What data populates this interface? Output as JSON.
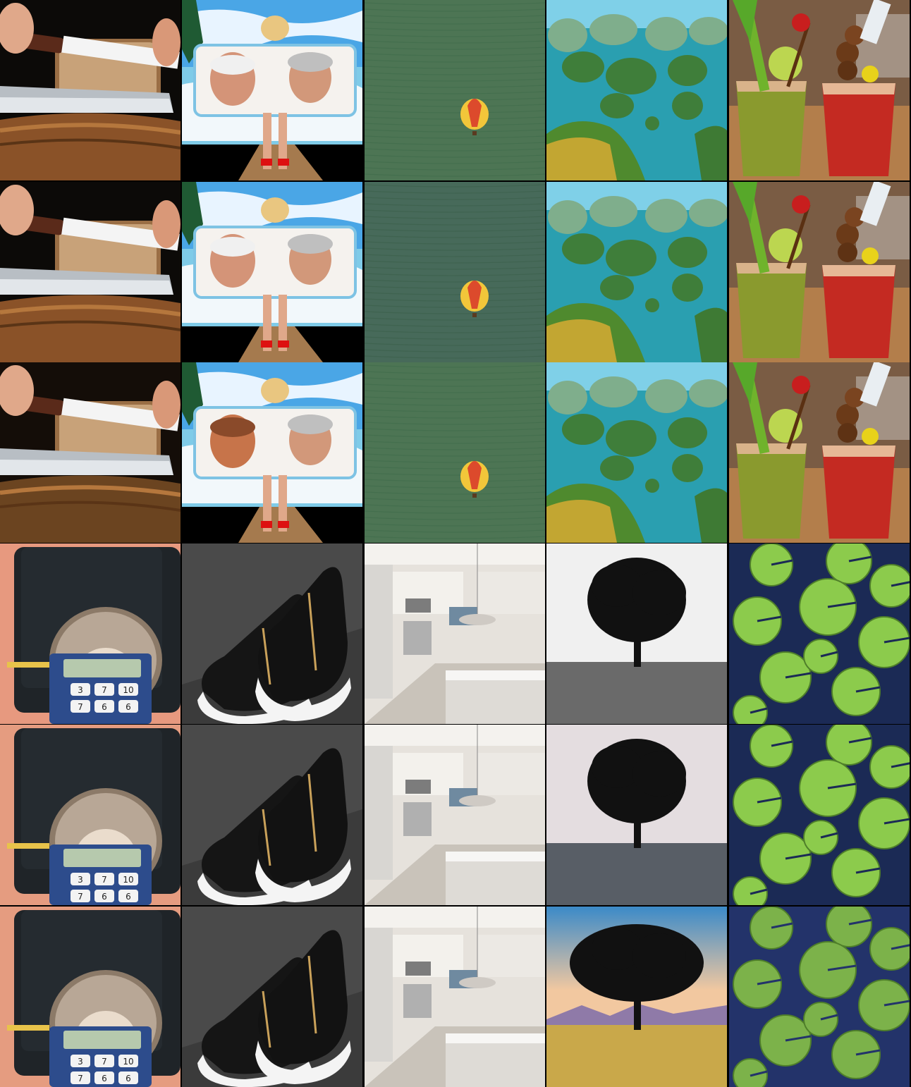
{
  "grid": {
    "rows": 6,
    "columns": 5,
    "tiles": [
      {
        "subject": "bread-knife",
        "variant": 1
      },
      {
        "subject": "beach-towel-faces",
        "variant": 1
      },
      {
        "subject": "hot-air-balloon-over-water",
        "variant": 1
      },
      {
        "subject": "karst-bay-islands",
        "variant": 1
      },
      {
        "subject": "bloody-mary-cocktails",
        "variant": 1
      },
      {
        "subject": "bread-knife",
        "variant": 2
      },
      {
        "subject": "beach-towel-faces",
        "variant": 2
      },
      {
        "subject": "hot-air-balloon-over-water",
        "variant": 2
      },
      {
        "subject": "karst-bay-islands",
        "variant": 2
      },
      {
        "subject": "bloody-mary-cocktails",
        "variant": 2
      },
      {
        "subject": "bread-knife",
        "variant": 3
      },
      {
        "subject": "beach-towel-faces",
        "variant": 3
      },
      {
        "subject": "hot-air-balloon-over-water",
        "variant": 3
      },
      {
        "subject": "karst-bay-islands",
        "variant": 3
      },
      {
        "subject": "bloody-mary-cocktails",
        "variant": 3
      },
      {
        "subject": "hedgehog-calculator",
        "variant": 1
      },
      {
        "subject": "black-sneakers",
        "variant": 1
      },
      {
        "subject": "white-kitchen",
        "variant": 1
      },
      {
        "subject": "lone-tree",
        "variant": 1
      },
      {
        "subject": "lily-pads",
        "variant": 1
      },
      {
        "subject": "hedgehog-calculator",
        "variant": 2
      },
      {
        "subject": "black-sneakers",
        "variant": 2
      },
      {
        "subject": "white-kitchen",
        "variant": 2
      },
      {
        "subject": "lone-tree",
        "variant": 2
      },
      {
        "subject": "lily-pads",
        "variant": 2
      },
      {
        "subject": "hedgehog-calculator",
        "variant": 3
      },
      {
        "subject": "black-sneakers",
        "variant": 3
      },
      {
        "subject": "white-kitchen",
        "variant": 3
      },
      {
        "subject": "lone-tree",
        "variant": 3
      },
      {
        "subject": "lily-pads",
        "variant": 3
      }
    ]
  },
  "calculator_keys": {
    "row1": [
      "3",
      "7",
      "10"
    ],
    "row2": [
      "7",
      "6",
      "6"
    ]
  }
}
